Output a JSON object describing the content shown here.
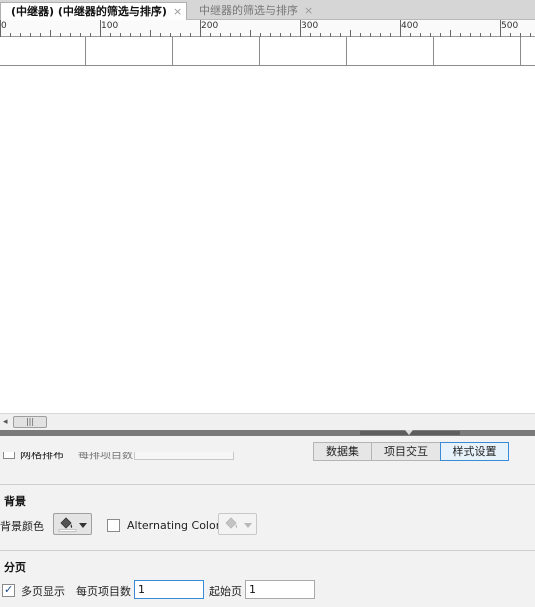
{
  "tabs": [
    {
      "label": "(中继器) (中继器的筛选与排序)",
      "close": "×",
      "active": true
    },
    {
      "label": "中继器的筛选与排序",
      "close": "×",
      "active": false
    }
  ],
  "ruler": {
    "labels": [
      "0",
      "100",
      "200",
      "300",
      "400",
      "500"
    ]
  },
  "panel": {
    "tabs": [
      "数据集",
      "项目交互",
      "样式设置"
    ],
    "active_tab": "样式设置",
    "partial_row": {
      "checkbox_label": "网格排布",
      "field_label": "每排项目数"
    },
    "background": {
      "title": "背景",
      "color_label": "背景颜色",
      "alternating_label": "Alternating Color",
      "alternating_checked": false
    },
    "paging": {
      "title": "分页",
      "multi_page_label": "多页显示",
      "multi_page_checked": true,
      "items_per_page_label": "每页项目数",
      "items_per_page_value": "1",
      "start_page_label": "起始页",
      "start_page_value": "1"
    }
  },
  "icons": {
    "paint_bucket": "paint-bucket-icon",
    "dropdown": "chevron-down-icon",
    "scroll_left": "arrow-left-icon",
    "close": "close-icon"
  },
  "colors": {
    "accent": "#3a8ad6",
    "tab_bar": "#d6d6d6",
    "panel_bg": "#f2f2f2",
    "splitter": "#7a7a7a"
  }
}
